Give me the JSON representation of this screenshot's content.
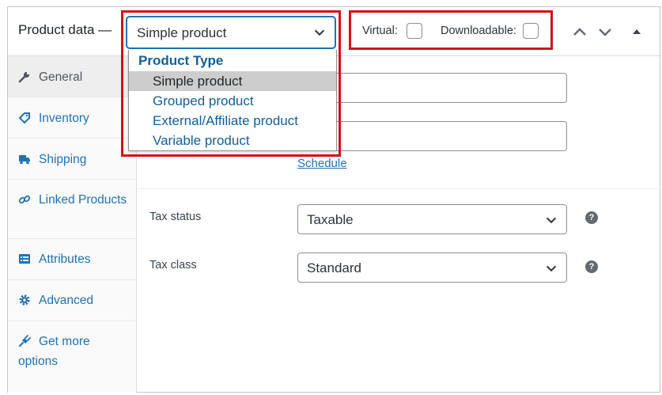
{
  "header": {
    "title": "Product data —",
    "product_type": {
      "selected": "Simple product",
      "group_label": "Product Type",
      "options": [
        "Simple product",
        "Grouped product",
        "External/Affiliate product",
        "Variable product"
      ]
    },
    "virtual_label": "Virtual:",
    "virtual_checked": false,
    "downloadable_label": "Downloadable:",
    "downloadable_checked": false,
    "icons": [
      "chevron-up-icon",
      "chevron-down-icon",
      "triangle-up-icon"
    ]
  },
  "sidebar": {
    "items": [
      {
        "label": "General",
        "icon": "wrench-icon",
        "active": true
      },
      {
        "label": "Inventory",
        "icon": "tag-icon"
      },
      {
        "label": "Shipping",
        "icon": "truck-icon"
      },
      {
        "label": "Linked Products",
        "icon": "link-icon"
      },
      {
        "label": "Attributes",
        "icon": "list-icon"
      },
      {
        "label": "Advanced",
        "icon": "gear-icon"
      },
      {
        "label": "Get more options",
        "icon": "plugin-icon"
      }
    ]
  },
  "general": {
    "schedule_link": "Schedule",
    "tax_status_label": "Tax status",
    "tax_status_value": "Taxable",
    "tax_class_label": "Tax class",
    "tax_class_value": "Standard",
    "help_glyph": "?"
  },
  "colors": {
    "link": "#2271b1",
    "highlight": "#d0121b",
    "selected_option_bg": "#cdcdcd"
  }
}
